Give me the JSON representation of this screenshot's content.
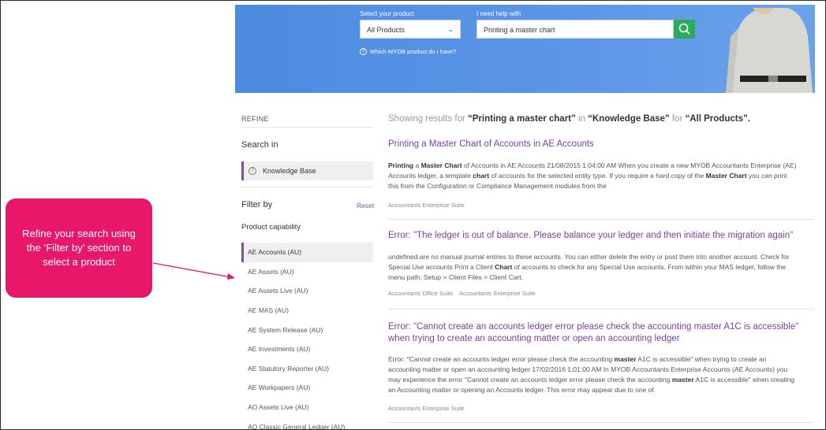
{
  "hero": {
    "product_label": "Select your product",
    "product_value": "All Products",
    "help_label": "I need help with",
    "help_value": "Printing a master chart",
    "which_product_link": "Which MYOB product do I have?"
  },
  "sidebar": {
    "refine_title": "REFINE",
    "search_in_title": "Search in",
    "search_in_item": "Knowledge Base",
    "filter_by_title": "Filter by",
    "reset_label": "Reset",
    "product_capability_title": "Product capability",
    "filters": [
      "AE Accounts (AU)",
      "AE Assets (AU)",
      "AE Assets Live (AU)",
      "AE MAS (AU)",
      "AE System Release (AU)",
      "AE Investments (AU)",
      "AE Statutory Reporter (AU)",
      "AE Workpapers (AU)",
      "AO Assets Live (AU)",
      "AO Classic General Ledger (AU)"
    ]
  },
  "callout": {
    "text": "Refine your search using the ‘Filter by’ section to select a product"
  },
  "results": {
    "summary_prefix": "Showing results for",
    "query": "“Printing a master chart”",
    "summary_in": "in",
    "scope": "“Knowledge Base”",
    "summary_for": "for",
    "product": "“All Products”.",
    "items": [
      {
        "title": "Printing a Master Chart of Accounts in AE Accounts",
        "snippet_line1_a": "Printing",
        "snippet_line1_b": " a ",
        "snippet_line1_c": "Master Chart",
        "snippet_line1_d": " of Accounts in AE Accounts 21/08/2015 1:04:00 AM When you create a new MYOB Accountants Enterprise (AE)",
        "snippet_line2_a": "Accounts ledger, a template ",
        "snippet_line2_b": "chart",
        "snippet_line2_c": " of accounts for the selected entity type. If you require a hard copy of the ",
        "snippet_line2_d": "Master Chart",
        "snippet_line2_e": " you can print",
        "snippet_line3": "this from the Configuration or Compliance Management modules from the",
        "tags": [
          "Accountants Enterprise Suite"
        ]
      },
      {
        "title": "Error: \"The ledger is out of balance. Please balance your ledger and then initiate the migration again\"",
        "snippet_line1": "undefined are no manual journal entries to these accounts. You can either delete the entry or post them into another account. Check for",
        "snippet_line2_a": "Special Use accounts Print a Client ",
        "snippet_line2_b": "Chart",
        "snippet_line2_c": " of accounts to check for any Special Use accounts. From within your MAS ledger, follow the",
        "snippet_line3": "menu path: Setup > Client Files > Client Cart.",
        "tags": [
          "Accountants Office Suite",
          "Accountants Enterprise Suite"
        ]
      },
      {
        "title_line1": "Error: \"Cannot create an accounts ledger error please check the accounting master A1C is accessible\"",
        "title_line2": "when trying to create an accounting matter or open an accounting ledger",
        "snippet_line1_a": "Error: \"Cannot create an accounts ledger error please check the accounting ",
        "snippet_line1_b": "master",
        "snippet_line1_c": " A1C is accessible\" when trying to create an",
        "snippet_line2": "accounting matter or open an accounting ledger 17/02/2016 1:01:00 AM In MYOB Accountants Enterprise Accounts (AE Accounts) you",
        "snippet_line3_a": "may experience the error \"Cannot create an accounts ledger error please check the accounting ",
        "snippet_line3_b": "master",
        "snippet_line3_c": " A1C is accessible\" when creating",
        "snippet_line4": "an Accounting matter or opening an Accounts ledger. This error may appear due to one of",
        "tags": [
          "Accountants Enterprise Suite"
        ]
      }
    ]
  },
  "colors": {
    "hero_blue": "#5b95e6",
    "search_green": "#2dab5d",
    "accent_purple": "#7a3fa0",
    "callout_pink": "#e8176a"
  },
  "icons": {
    "search": "magnifier-icon",
    "dropdown": "chevron-down-icon",
    "help": "question-circle-icon"
  }
}
